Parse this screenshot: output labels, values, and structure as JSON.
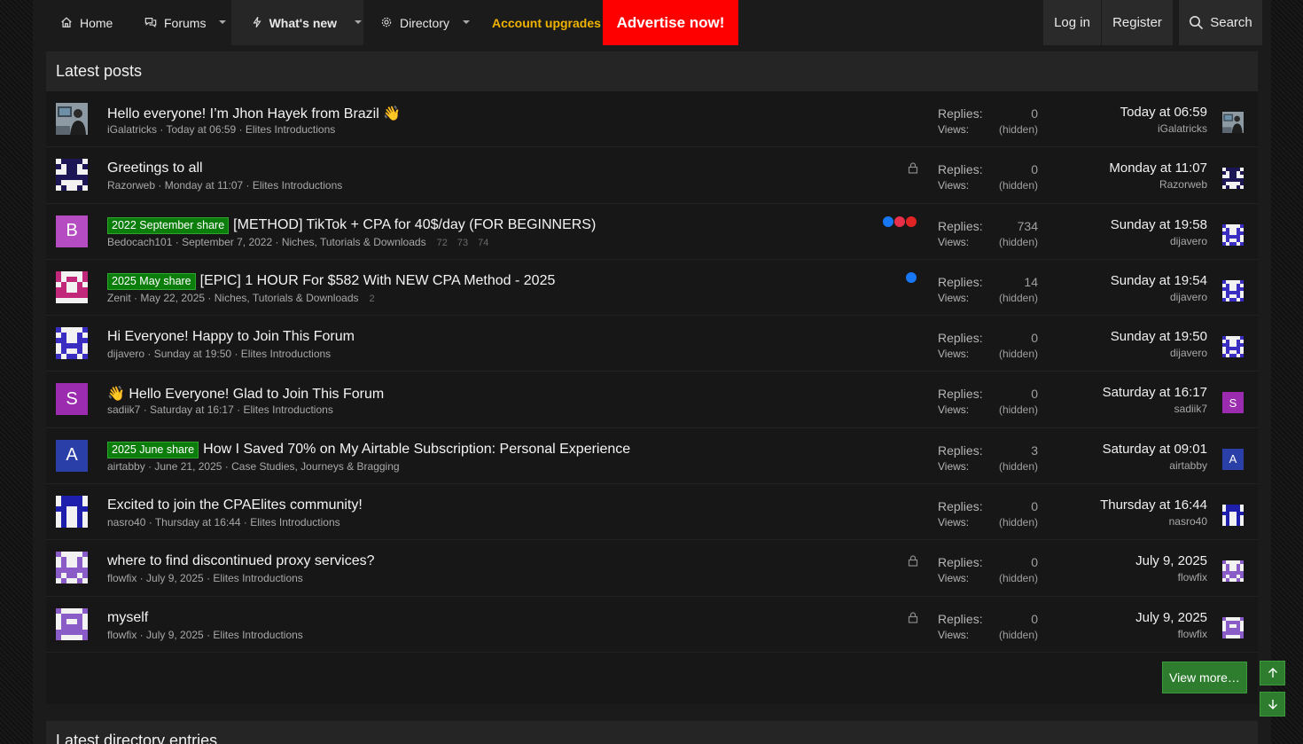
{
  "nav": {
    "home": "Home",
    "forums": "Forums",
    "whats_new": "What's new",
    "directory": "Directory",
    "account_upgrades": "Account upgrades",
    "advertise": "Advertise now!",
    "login": "Log in",
    "register": "Register",
    "search": "Search"
  },
  "colors": {
    "accent_green": "#2e7d2e",
    "advertise_red": "#ff0000",
    "upgrades_gold": "#f0b400",
    "prefix_green": "#0b7d0b"
  },
  "latest_posts": {
    "title": "Latest posts",
    "replies_label": "Replies:",
    "views_label": "Views:",
    "view_more": "View more…",
    "threads": [
      {
        "title": "Hello everyone! I’m Jhon Hayek from Brazil 👋",
        "prefix": "",
        "author": "iGalatricks",
        "date": "Today at 06:59",
        "forum": "Elites Introductions",
        "pages": "",
        "replies": "0",
        "views": "(hidden)",
        "last_date": "Today at 06:59",
        "last_user": "iGalatricks",
        "locked": false,
        "reactions": [],
        "avatar": {
          "type": "photo",
          "letter": "",
          "color": "#5a6a78"
        }
      },
      {
        "title": "Greetings to all",
        "prefix": "",
        "author": "Razorweb",
        "date": "Monday at 11:07",
        "forum": "Elites Introductions",
        "pages": "",
        "replies": "0",
        "views": "(hidden)",
        "last_date": "Monday at 11:07",
        "last_user": "Razorweb",
        "locked": true,
        "reactions": [],
        "avatar": {
          "type": "identicon",
          "letter": "",
          "color": "#1d1655"
        }
      },
      {
        "title": "[METHOD] TikTok + CPA for 40$/day (FOR BEGINNERS)",
        "prefix": "2022 September share",
        "author": "Bedocach101",
        "date": "September 7, 2022",
        "forum": "Niches, Tutorials & Downloads",
        "pages": "72 73 74",
        "replies": "734",
        "views": "(hidden)",
        "last_date": "Sunday at 19:58",
        "last_user": "dijavero",
        "locked": false,
        "reactions": [
          "like",
          "love",
          "dislike"
        ],
        "avatar": {
          "type": "letter",
          "letter": "B",
          "color": "#b54cc2"
        }
      },
      {
        "title": "[EPIC] 1 HOUR For $582 With NEW CPA Method - 2025",
        "prefix": "2025 May share",
        "author": "Zenit",
        "date": "May 22, 2025",
        "forum": "Niches, Tutorials & Downloads",
        "pages": "2",
        "replies": "14",
        "views": "(hidden)",
        "last_date": "Sunday at 19:54",
        "last_user": "dijavero",
        "locked": false,
        "reactions": [
          "like"
        ],
        "avatar": {
          "type": "identicon",
          "letter": "",
          "color": "#c2287a"
        }
      },
      {
        "title": "Hi Everyone! Happy to Join This Forum",
        "prefix": "",
        "author": "dijavero",
        "date": "Sunday at 19:50",
        "forum": "Elites Introductions",
        "pages": "",
        "replies": "0",
        "views": "(hidden)",
        "last_date": "Sunday at 19:50",
        "last_user": "dijavero",
        "locked": false,
        "reactions": [],
        "avatar": {
          "type": "identicon",
          "letter": "",
          "color": "#3a2dc2"
        }
      },
      {
        "title": "👋 Hello Everyone! Glad to Join This Forum",
        "prefix": "",
        "author": "sadiik7",
        "date": "Saturday at 16:17",
        "forum": "Elites Introductions",
        "pages": "",
        "replies": "0",
        "views": "(hidden)",
        "last_date": "Saturday at 16:17",
        "last_user": "sadiik7",
        "locked": false,
        "reactions": [],
        "avatar": {
          "type": "letter",
          "letter": "S",
          "color": "#9b2cb0"
        }
      },
      {
        "title": "How I Saved 70% on My Airtable Subscription: Personal Experience",
        "prefix": "2025 June share",
        "author": "airtabby",
        "date": "June 21, 2025",
        "forum": "Case Studies, Journeys & Bragging",
        "pages": "",
        "replies": "3",
        "views": "(hidden)",
        "last_date": "Saturday at 09:01",
        "last_user": "airtabby",
        "locked": false,
        "reactions": [],
        "avatar": {
          "type": "letter",
          "letter": "A",
          "color": "#2a3fa8"
        }
      },
      {
        "title": "Excited to join the CPAElites community!",
        "prefix": "",
        "author": "nasro40",
        "date": "Thursday at 16:44",
        "forum": "Elites Introductions",
        "pages": "",
        "replies": "0",
        "views": "(hidden)",
        "last_date": "Thursday at 16:44",
        "last_user": "nasro40",
        "locked": false,
        "reactions": [],
        "avatar": {
          "type": "identicon",
          "letter": "",
          "color": "#1f1fae"
        }
      },
      {
        "title": "where to find discontinued proxy services?",
        "prefix": "",
        "author": "flowfix",
        "date": "July 9, 2025",
        "forum": "Elites Introductions",
        "pages": "",
        "replies": "0",
        "views": "(hidden)",
        "last_date": "July 9, 2025",
        "last_user": "flowfix",
        "locked": true,
        "reactions": [],
        "avatar": {
          "type": "identicon",
          "letter": "",
          "color": "#8a5cc8"
        }
      },
      {
        "title": "myself",
        "prefix": "",
        "author": "flowfix",
        "date": "July 9, 2025",
        "forum": "Elites Introductions",
        "pages": "",
        "replies": "0",
        "views": "(hidden)",
        "last_date": "July 9, 2025",
        "last_user": "flowfix",
        "locked": true,
        "reactions": [],
        "avatar": {
          "type": "identicon",
          "letter": "",
          "color": "#8a5cc8"
        }
      }
    ]
  },
  "latest_directory": {
    "title": "Latest directory entries"
  }
}
